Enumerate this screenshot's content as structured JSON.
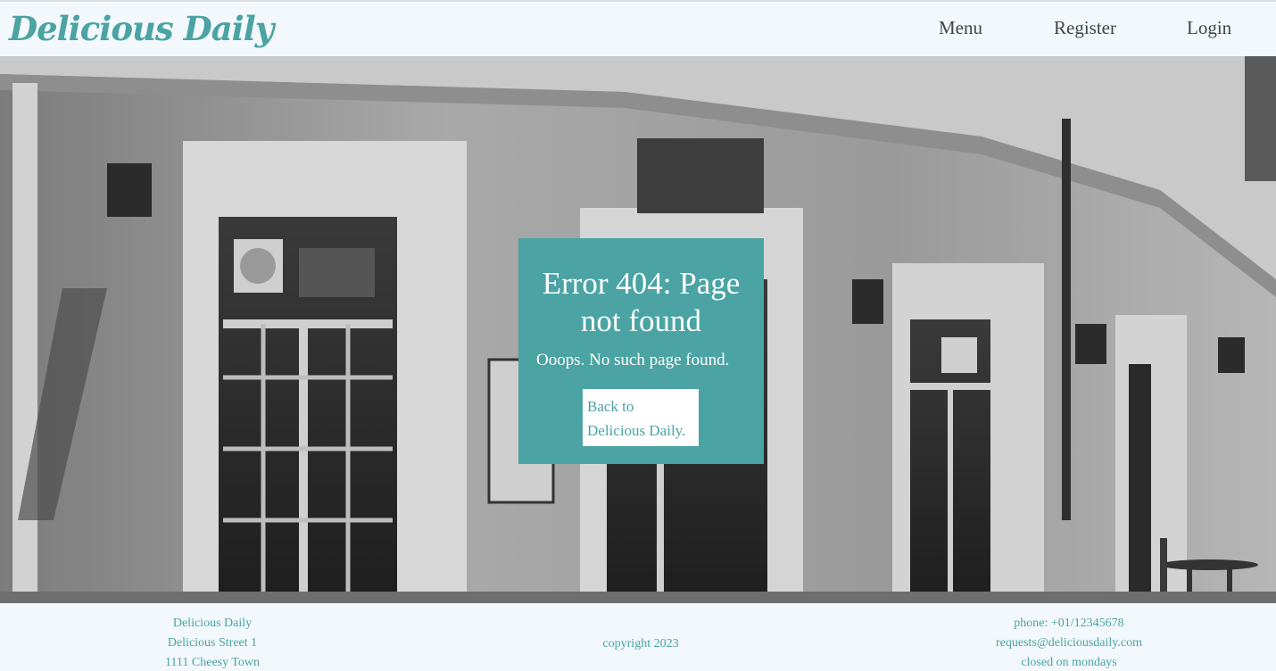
{
  "header": {
    "logo": "Delicious Daily",
    "nav": {
      "menu": "Menu",
      "register": "Register",
      "login": "Login"
    }
  },
  "error": {
    "title": "Error 404: Page not found",
    "message": "Ooops. No such page found.",
    "back_link": "Back to Delicious Daily."
  },
  "footer": {
    "left": [
      "Delicious Daily",
      "Delicious Street 1",
      "1111 Cheesy Town"
    ],
    "middle": "copyright 2023",
    "right": [
      "phone: +01/12345678",
      "requests@deliciousdaily.com",
      "closed on mondays"
    ]
  },
  "colors": {
    "accent": "#4ba3a3",
    "background": "#f2f8fc",
    "nav_text": "#444444"
  },
  "hero_image": "black-and-white photo of a Greek cafe facade (Kafeneion Koze cafe bar) with windows, wall lamps and a chalkboard menu"
}
